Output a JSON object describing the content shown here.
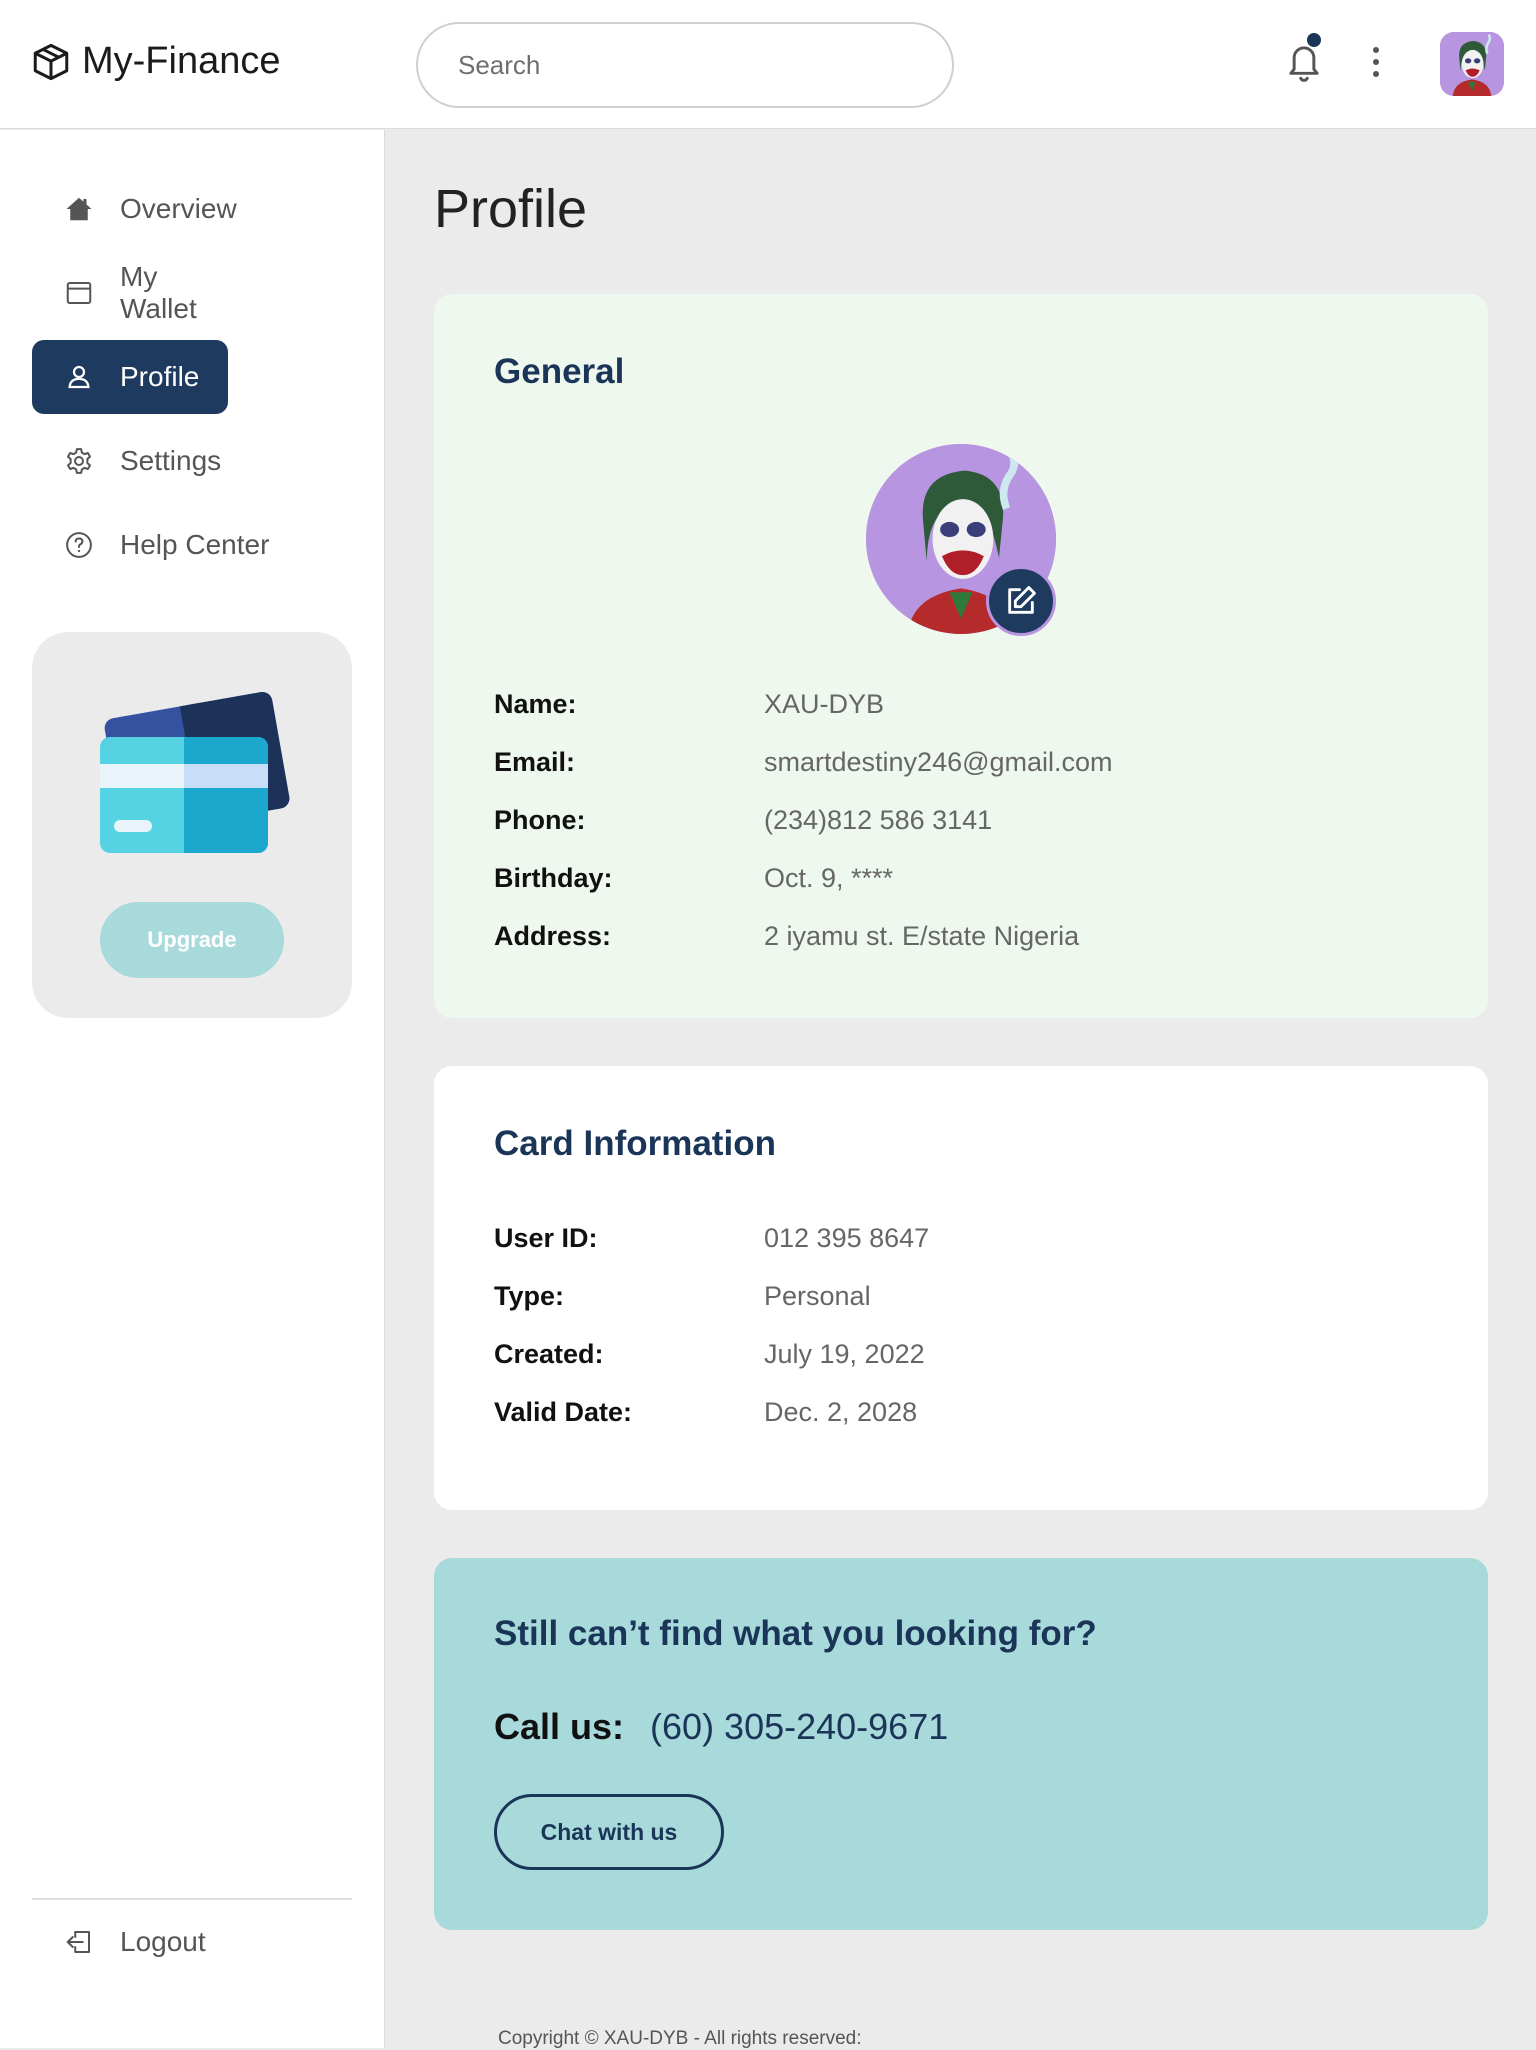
{
  "brand": {
    "name": "My-Finance",
    "icon": "cube-icon"
  },
  "search": {
    "placeholder": "Search"
  },
  "header": {
    "notification_icon": "bell-icon",
    "menu_icon": "kebab-icon",
    "avatar": "joker-avatar"
  },
  "sidebar": {
    "items": [
      {
        "label": "Overview",
        "icon": "home-icon",
        "active": false
      },
      {
        "label": "My Wallet",
        "icon": "wallet-icon",
        "active": false
      },
      {
        "label": "Profile",
        "icon": "user-icon",
        "active": true
      },
      {
        "label": "Settings",
        "icon": "gear-icon",
        "active": false
      },
      {
        "label": "Help Center",
        "icon": "question-icon",
        "active": false
      }
    ],
    "promo": {
      "button_label": "Upgrade",
      "illustration": "credit-cards-illustration"
    },
    "logout_label": "Logout"
  },
  "page": {
    "title": "Profile"
  },
  "general": {
    "title": "General",
    "fields": [
      {
        "label": "Name:",
        "value": "XAU-DYB"
      },
      {
        "label": "Email:",
        "value": "smartdestiny246@gmail.com"
      },
      {
        "label": "Phone:",
        "value": "(234)812 586 3141"
      },
      {
        "label": "Birthday:",
        "value": "Oct. 9, ****"
      },
      {
        "label": "Address:",
        "value": "2 iyamu st. E/state Nigeria"
      }
    ]
  },
  "card_info": {
    "title": "Card Information",
    "fields": [
      {
        "label": "User ID:",
        "value": "012 395 8647"
      },
      {
        "label": "Type:",
        "value": "Personal"
      },
      {
        "label": "Created:",
        "value": "July 19, 2022"
      },
      {
        "label": "Valid Date:",
        "value": "Dec. 2, 2028"
      }
    ]
  },
  "help": {
    "title": "Still can’t find what you looking for?",
    "call_label": "Call us:",
    "call_number": "(60) 305-240-9671",
    "chat_label": "Chat with us"
  },
  "footer": {
    "text": "Copyright © XAU-DYB - All rights reserved:"
  },
  "colors": {
    "navy": "#1f3a5f",
    "heading": "#1a3558",
    "general_bg": "#eff8ee",
    "help_bg": "#a8d9db",
    "avatar_bg": "#b795e0",
    "notification_dot": "#1a3558"
  }
}
